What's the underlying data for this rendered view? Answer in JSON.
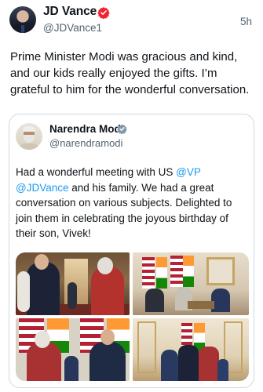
{
  "author": {
    "name": "JD Vance",
    "handle": "@JDVance1",
    "timestamp": "5h",
    "badge_color": "#f4212e"
  },
  "tweet": {
    "text": "Prime Minister Modi was gracious and kind, and our kids really enjoyed the gifts. I’m grateful to him for the wonderful conversation."
  },
  "quoted_tweet": {
    "author_name": "Narendra Modi",
    "author_handle": "@narendramodi",
    "badge_color": "#829aab",
    "text_part1": "Had a wonderful meeting with US ",
    "mention_vp": "@VP",
    "mention_jd": "@JDVance",
    "text_part2": " and his family. We had a great conversation on various subjects. Delighted to join them in celebrating the joyous birthday of their son, Vivek!",
    "link_color": "#1d9bf0"
  },
  "media": {
    "photo_count": 4
  }
}
